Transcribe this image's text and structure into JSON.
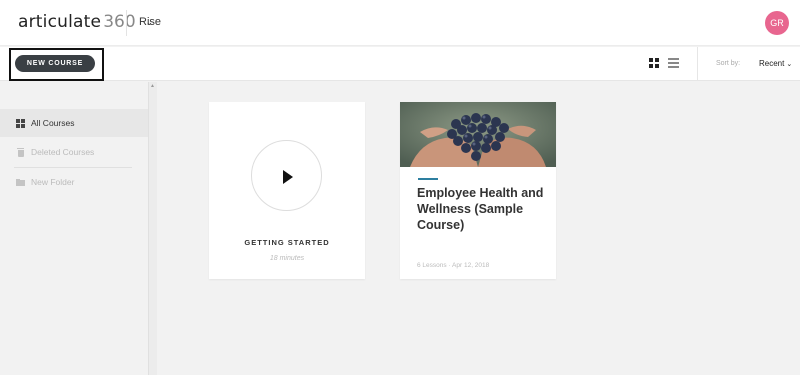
{
  "header": {
    "brand": "articulate",
    "brand_number": "360",
    "brand_caret": "⌄",
    "app_name": "Rise",
    "avatar_initials": "GR",
    "avatar_color": "#e8668f"
  },
  "toolbar": {
    "new_course_label": "NEW COURSE",
    "sort_label": "Sort by:",
    "sort_value": "Recent",
    "sort_caret": "⌄",
    "view_grid_icon": "grid-icon",
    "view_list_icon": "list-icon"
  },
  "sidebar": {
    "items": [
      {
        "label": "All Courses",
        "icon": "grid-icon",
        "active": true
      },
      {
        "label": "Deleted Courses",
        "icon": "trash-icon",
        "active": false
      },
      {
        "label": "New Folder",
        "icon": "folder-plus-icon",
        "active": false
      }
    ]
  },
  "cards": {
    "getting_started": {
      "title": "GETTING STARTED",
      "duration": "18 minutes",
      "icon": "play-icon"
    },
    "course": {
      "title": "Employee Health and Wellness (Sample Course)",
      "meta": "6 Lessons · Apr 12, 2018",
      "accent_color": "#2d7fa0",
      "image": "hands-holding-grapes"
    }
  }
}
